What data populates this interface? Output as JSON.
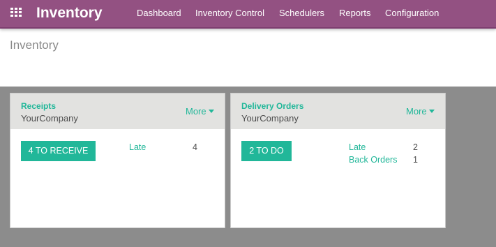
{
  "topbar": {
    "app_title": "Inventory",
    "apps_icon": "grid-icon",
    "menu": [
      "Dashboard",
      "Inventory Control",
      "Schedulers",
      "Reports",
      "Configuration"
    ]
  },
  "breadcrumb": "Inventory",
  "cards": [
    {
      "title": "Receipts",
      "company": "YourCompany",
      "more": "More",
      "button": "4 TO RECEIVE",
      "stats": [
        {
          "label": "Late",
          "count": "4"
        }
      ]
    },
    {
      "title": "Delivery Orders",
      "company": "YourCompany",
      "more": "More",
      "button": "2 TO DO",
      "stats": [
        {
          "label": "Late",
          "count": "2"
        },
        {
          "label": "Back Orders",
          "count": "1"
        }
      ]
    }
  ],
  "colors": {
    "topbar": "#935182",
    "accent": "#21b799",
    "dashboard_bg": "#8c8c8c",
    "card_header": "#e2e2e0"
  }
}
